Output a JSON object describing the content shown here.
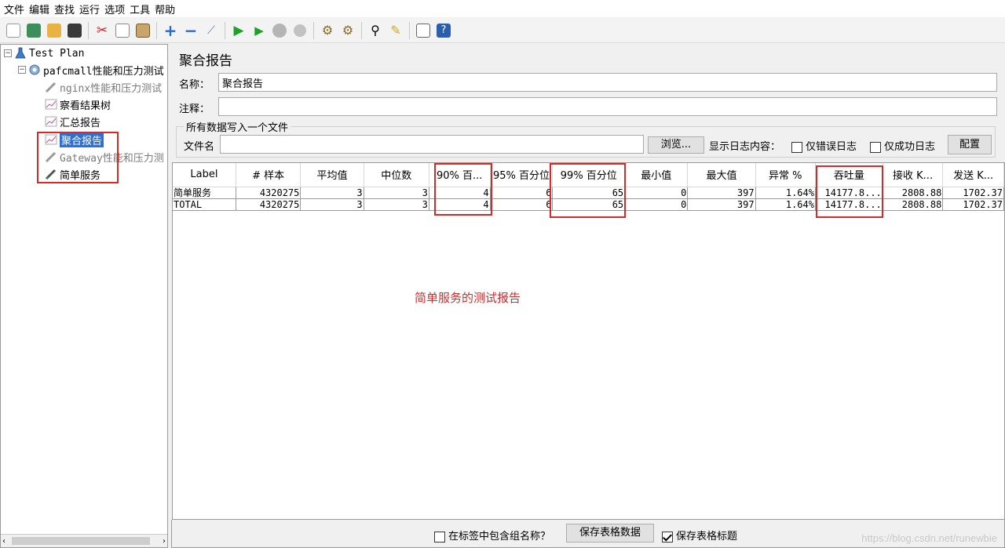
{
  "menu": [
    "文件",
    "编辑",
    "查找",
    "运行",
    "选项",
    "工具",
    "帮助"
  ],
  "toolbar_icons": [
    "new-icon",
    "templates-icon",
    "open-icon",
    "save-icon",
    "cut-icon",
    "copy-icon",
    "paste-icon",
    "expand-icon",
    "collapse-icon",
    "toggle-icon",
    "start-icon",
    "start-no-pause-icon",
    "stop-icon",
    "shutdown-icon",
    "clear-icon",
    "clear-all-icon",
    "search-icon",
    "reset-search-icon",
    "function-helper-icon",
    "help-icon"
  ],
  "tree": {
    "root": "Test Plan",
    "group": "pafcmall性能和压力测试",
    "items": [
      {
        "label": "nginx性能和压力测试",
        "disabled": true
      },
      {
        "label": "察看结果树",
        "disabled": false
      },
      {
        "label": "汇总报告",
        "disabled": false
      },
      {
        "label": "聚合报告",
        "disabled": false,
        "selected": true
      },
      {
        "label": "Gateway性能和压力测",
        "disabled": true
      },
      {
        "label": "简单服务",
        "disabled": false
      }
    ]
  },
  "report": {
    "title": "聚合报告",
    "name_label": "名称：",
    "name_value": "聚合报告",
    "comment_label": "注释：",
    "comment_value": "",
    "file_group_title": "所有数据写入一个文件",
    "file_label": "文件名",
    "file_value": "",
    "browse_button": "浏览...",
    "log_label": "显示日志内容：",
    "error_log_label": "仅错误日志",
    "success_log_label": "仅成功日志",
    "config_button": "配置"
  },
  "table": {
    "headers": [
      "Label",
      "# 样本",
      "平均值",
      "中位数",
      "90% 百...",
      "95% 百分位",
      "99% 百分位",
      "最小值",
      "最大值",
      "异常 %",
      "吞吐量",
      "接收 K...",
      "发送 K..."
    ],
    "rows": [
      [
        "简单服务",
        "4320275",
        "3",
        "3",
        "4",
        "6",
        "65",
        "0",
        "397",
        "1.64%",
        "14177.8...",
        "2808.88",
        "1702.37"
      ],
      [
        "TOTAL",
        "4320275",
        "3",
        "3",
        "4",
        "6",
        "65",
        "0",
        "397",
        "1.64%",
        "14177.8...",
        "2808.88",
        "1702.37"
      ]
    ]
  },
  "annotation": "简单服务的测试报告",
  "bottom": {
    "include_group_label": "在标签中包含组名称？",
    "include_group_checked": false,
    "save_table_button": "保存表格数据",
    "save_header_label": "保存表格标题",
    "save_header_checked": true
  },
  "watermark": "https://blog.csdn.net/runewbie",
  "colors": {
    "highlight_box": "#d42a2a",
    "selection": "#2f6fd0"
  }
}
